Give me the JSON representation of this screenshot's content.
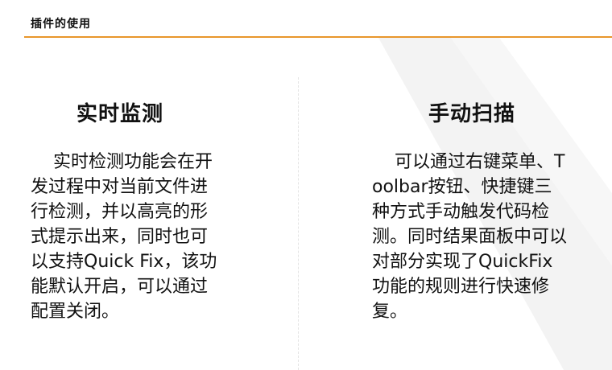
{
  "header": {
    "title": "插件的使用"
  },
  "columns": [
    {
      "heading": "实时监测",
      "body": "    实时检测功能会在开发过程中对当前文件进行检测，并以高亮的形式提示出来，同时也可以支持Quick Fix，该功能默认开启，可以通过配置关闭。"
    },
    {
      "heading": "手动扫描",
      "body": "    可以通过右键菜单、Toolbar按钮、快捷键三种方式手动触发代码检测。同时结果面板中可以对部分实现了QuickFix功能的规则进行快速修复。"
    }
  ],
  "colors": {
    "accent": "#e8962b",
    "text": "#111111",
    "decoration": "#f2f2f2"
  }
}
